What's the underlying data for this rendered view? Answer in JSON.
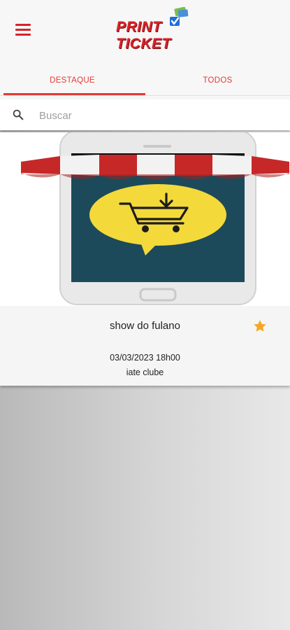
{
  "app": {
    "logo_line1": "PRINT",
    "logo_line2": "TICKET",
    "menu_icon": "hamburger-menu-icon",
    "brand_color": "#d8232a"
  },
  "tabs": [
    {
      "label": "DESTAQUE",
      "active": true
    },
    {
      "label": "TODOS",
      "active": false
    }
  ],
  "search": {
    "placeholder": "Buscar",
    "value": "",
    "icon": "search-icon"
  },
  "events": [
    {
      "title": "show do fulano",
      "date": "03/03/2023 18h00",
      "venue": "iate clube",
      "favorite": true,
      "favorite_color": "#f5a623",
      "image": "storefront-phone-cart-illustration"
    }
  ]
}
